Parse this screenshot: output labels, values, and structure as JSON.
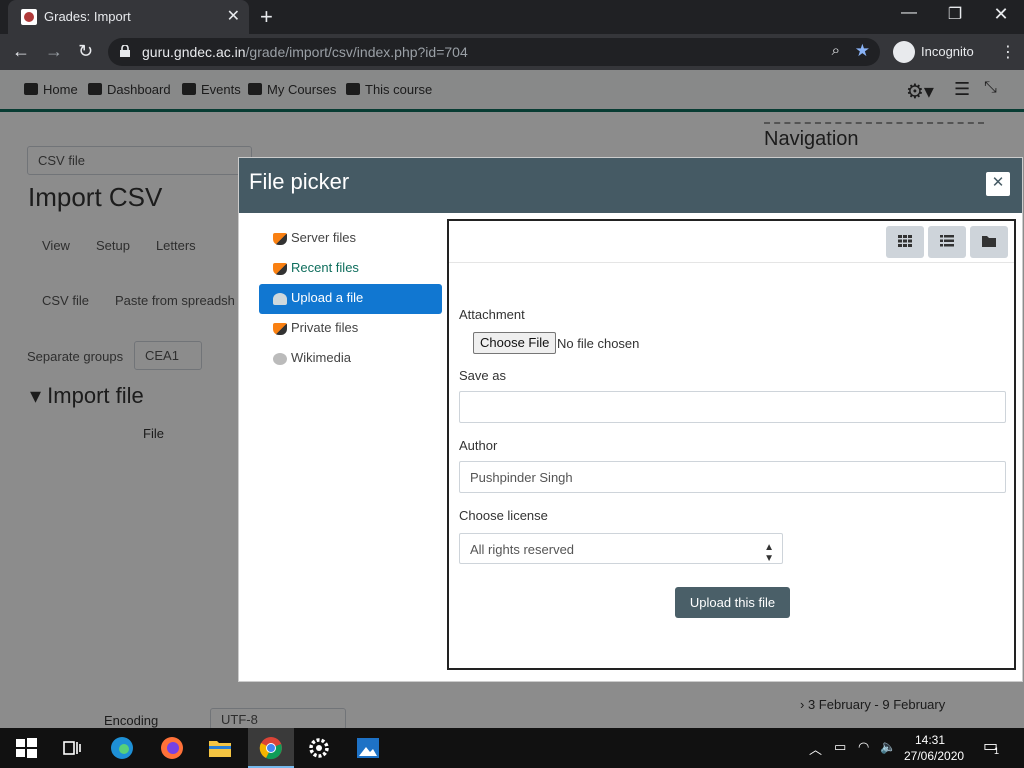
{
  "browser": {
    "tab_title": "Grades: Import",
    "url_host": "guru.gndec.ac.in",
    "url_path": "/grade/import/csv/index.php?id=704",
    "incognito_label": "Incognito"
  },
  "moodle_nav": {
    "items": [
      "Home",
      "Dashboard",
      "Events",
      "My Courses",
      "This course"
    ]
  },
  "background": {
    "import_select": "CSV file",
    "heading": "Import CSV",
    "tabs": [
      "View",
      "Setup",
      "Letters"
    ],
    "subtabs": [
      "CSV file",
      "Paste from spreadsh"
    ],
    "separate_groups_label": "Separate groups",
    "separate_groups_value": "CEA1",
    "section": "Import file",
    "file_label": "File",
    "encoding_label": "Encoding",
    "encoding_value": "UTF-8",
    "nav_block_title": "Navigation",
    "nav_items": [
      "3 February - 9 February"
    ]
  },
  "file_picker": {
    "title": "File picker",
    "repositories": [
      "Server files",
      "Recent files",
      "Upload a file",
      "Private files",
      "Wikimedia"
    ],
    "attachment_label": "Attachment",
    "choose_file_button": "Choose File",
    "no_file_text": "No file chosen",
    "save_as_label": "Save as",
    "save_as_value": "",
    "author_label": "Author",
    "author_value": "Pushpinder Singh",
    "license_label": "Choose license",
    "license_value": "All rights reserved",
    "upload_button": "Upload this file"
  },
  "taskbar": {
    "time": "14:31",
    "date": "27/06/2020",
    "notification_count": "1"
  }
}
